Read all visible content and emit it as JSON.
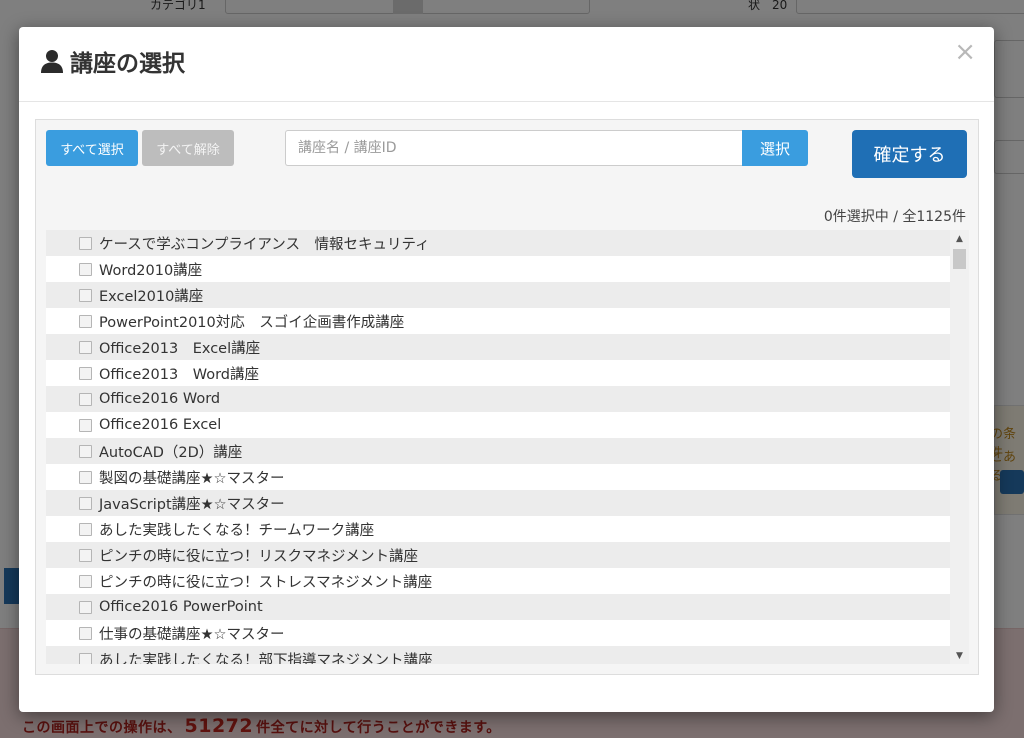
{
  "background": {
    "alert_prefix": "この画面上での操作は、",
    "alert_count": "51272",
    "alert_suffix": "件全てに対して行うことができます。",
    "side_text_1": "の条件",
    "side_text_2": "とある",
    "top_label_1": "カテゴリ1",
    "top_label_2": "状　20"
  },
  "modal": {
    "title": "講座の選択",
    "close_label": "×",
    "select_all_label": "すべて選択",
    "deselect_all_label": "すべて解除",
    "search": {
      "placeholder": "講座名 / 講座ID",
      "value": ""
    },
    "search_button_label": "選択",
    "confirm_button_label": "確定する",
    "count_label": "0件選択中 / 全1125件",
    "courses": [
      "ケースで学ぶコンプライアンス　情報セキュリティ",
      "Word2010講座",
      "Excel2010講座",
      "PowerPoint2010対応　スゴイ企画書作成講座",
      "Office2013　Excel講座",
      "Office2013　Word講座",
      "Office2016 Word",
      "Office2016 Excel",
      "AutoCAD（2D）講座",
      "製図の基礎講座★☆マスター",
      "JavaScript講座★☆マスター",
      "あした実践したくなる！チームワーク講座",
      "ピンチの時に役に立つ！リスクマネジメント講座",
      "ピンチの時に役に立つ！ストレスマネジメント講座",
      "Office2016 PowerPoint",
      "仕事の基礎講座★☆マスター",
      "あした実践したくなる！部下指導マネジメント講座"
    ],
    "colors": {
      "primary": "#3a9ddf",
      "confirm": "#1f6fb5",
      "disabled": "#bdbdbd"
    }
  }
}
